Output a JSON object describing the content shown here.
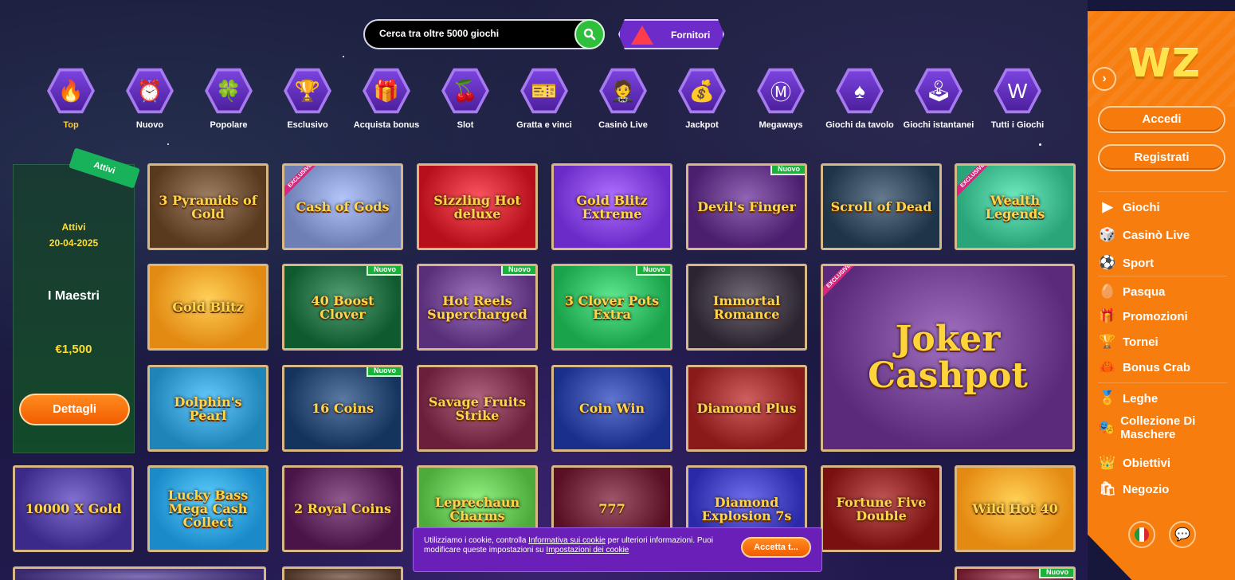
{
  "search": {
    "placeholder": "Cerca tra oltre 5000 giochi"
  },
  "providers_label": "Fornitori",
  "categories": [
    {
      "label": "Top",
      "icon": "fire-icon",
      "glyph": "🔥",
      "active": true
    },
    {
      "label": "Nuovo",
      "icon": "alarm-clock-icon",
      "glyph": "⏰"
    },
    {
      "label": "Popolare",
      "icon": "clover-icon",
      "glyph": "🍀"
    },
    {
      "label": "Esclusivo",
      "icon": "trophy-icon",
      "glyph": "🏆"
    },
    {
      "label": "Acquista bonus",
      "icon": "gift-icon",
      "glyph": "🎁"
    },
    {
      "label": "Slot",
      "icon": "cherries-icon",
      "glyph": "🍒"
    },
    {
      "label": "Gratta e vinci",
      "icon": "scratch-card-icon",
      "glyph": "🎫"
    },
    {
      "label": "Casinò Live",
      "icon": "dealer-icon",
      "glyph": "🤵"
    },
    {
      "label": "Jackpot",
      "icon": "money-bag-icon",
      "glyph": "💰"
    },
    {
      "label": "Megaways",
      "icon": "megaways-m-icon",
      "glyph": "Ⓜ"
    },
    {
      "label": "Giochi da tavolo",
      "icon": "spade-card-icon",
      "glyph": "♠"
    },
    {
      "label": "Giochi istantanei",
      "icon": "joystick-icon",
      "glyph": "🕹"
    },
    {
      "label": "Tutti i Giochi",
      "icon": "w-badge-icon",
      "glyph": "W"
    }
  ],
  "tournament": {
    "ribbon": "Attivi",
    "status": "Attivi",
    "date": "20-04-2025",
    "name": "I Maestri",
    "prize": "€1,500",
    "button": "Dettagli"
  },
  "games": [
    {
      "title": "3 Pyramids of Gold",
      "bg": "#5a3a1e",
      "badge": ""
    },
    {
      "title": "Cash of Gods",
      "bg": "#6d7fb5",
      "badge": "",
      "exclusive": "EXCLUSIVE"
    },
    {
      "title": "Sizzling Hot deluxe",
      "bg": "#b8101a",
      "badge": ""
    },
    {
      "title": "Gold Blitz Extreme",
      "bg": "#6b2bc9",
      "badge": ""
    },
    {
      "title": "Devil's Finger",
      "bg": "#4b1f6e",
      "badge": "Nuovo"
    },
    {
      "title": "Scroll of Dead",
      "bg": "#1f3448",
      "badge": ""
    },
    {
      "title": "Wealth Legends",
      "bg": "#2aa57a",
      "badge": "",
      "exclusive": "EXCLUSIVE"
    },
    {
      "title": "Gold Blitz",
      "bg": "#e28a12",
      "badge": ""
    },
    {
      "title": "40 Boost Clover",
      "bg": "#0f5a2e",
      "badge": "Nuovo"
    },
    {
      "title": "Hot Reels Supercharged",
      "bg": "#5a2f7a",
      "badge": "Nuovo"
    },
    {
      "title": "3 Clover Pots Extra",
      "bg": "#1aa34a",
      "badge": "Nuovo"
    },
    {
      "title": "Immortal Romance",
      "bg": "#2c2530",
      "badge": ""
    },
    {
      "title": "Joker Cashpot",
      "bg": "#5b2a7a",
      "badge": "",
      "exclusive": "EXCLUSIVE"
    },
    {
      "title": "Dolphin's Pearl",
      "bg": "#1f84b8",
      "badge": ""
    },
    {
      "title": "16 Coins",
      "bg": "#14345e",
      "badge": "Nuovo"
    },
    {
      "title": "Savage Fruits Strike",
      "bg": "#6b1f3a",
      "badge": ""
    },
    {
      "title": "Coin Win",
      "bg": "#1a2f8a",
      "badge": ""
    },
    {
      "title": "Diamond Plus",
      "bg": "#8a1a1a",
      "badge": ""
    },
    {
      "title": "10000 X Gold",
      "bg": "#3b2a8a",
      "badge": ""
    },
    {
      "title": "Lucky Bass Mega Cash Collect",
      "bg": "#1a8ac9",
      "badge": ""
    },
    {
      "title": "2 Royal Coins",
      "bg": "#4a1448",
      "badge": ""
    },
    {
      "title": "Leprechaun Charms",
      "bg": "#4cab3a",
      "badge": ""
    },
    {
      "title": "777",
      "bg": "#5a1024",
      "badge": ""
    },
    {
      "title": "Diamond Explosion 7s",
      "bg": "#2a2aa8",
      "badge": ""
    },
    {
      "title": "Fortune Five Double",
      "bg": "#7a1010",
      "badge": ""
    },
    {
      "title": "Wild Hot 40",
      "bg": "#e58a10",
      "badge": ""
    },
    {
      "title": "",
      "bg": "#3b2b6e",
      "badge": ""
    },
    {
      "title": "",
      "bg": "#4a3224",
      "badge": ""
    },
    {
      "title": "",
      "bg": "#6a1a2a",
      "badge": "Nuovo"
    }
  ],
  "sidebar": {
    "logo": "WZ",
    "login": "Accedi",
    "register": "Registrati",
    "menu": [
      {
        "label": "Giochi",
        "icon": "play-icon",
        "glyph": "▶"
      },
      {
        "label": "Casinò Live",
        "icon": "dice-icon",
        "glyph": "🎲"
      },
      {
        "label": "Sport",
        "icon": "football-icon",
        "glyph": "⚽"
      },
      {
        "label": "Pasqua",
        "icon": "easter-egg-icon",
        "glyph": "🥚"
      },
      {
        "label": "Promozioni",
        "icon": "gift-icon",
        "glyph": "🎁"
      },
      {
        "label": "Tornei",
        "icon": "trophy-icon",
        "glyph": "🏆"
      },
      {
        "label": "Bonus Crab",
        "icon": "crab-claw-icon",
        "glyph": "🦀"
      },
      {
        "label": "Leghe",
        "icon": "league-icon",
        "glyph": "🏅"
      },
      {
        "label": "Collezione Di Maschere",
        "icon": "mask-icon",
        "glyph": "🎭"
      },
      {
        "label": "Obiettivi",
        "icon": "crown-icon",
        "glyph": "👑"
      },
      {
        "label": "Negozio",
        "icon": "shop-icon",
        "glyph": "🛍"
      }
    ]
  },
  "cookie": {
    "text1": "Utilizziamo i cookie, controlla ",
    "link1": "Informativa sui cookie",
    "text2": " per ulteriori informazioni. Puoi modificare queste impostazioni su ",
    "link2": "Impostazioni dei cookie",
    "accept": "Accetta t..."
  }
}
